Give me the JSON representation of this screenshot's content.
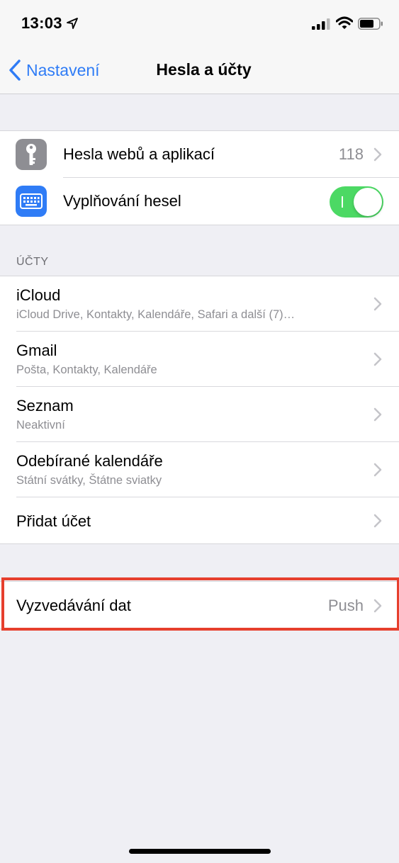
{
  "status_bar": {
    "time": "13:03"
  },
  "nav": {
    "back_label": "Nastavení",
    "title": "Hesla a účty"
  },
  "passwords": {
    "web_passwords_label": "Hesla webů a aplikací",
    "web_passwords_count": "118",
    "autofill_label": "Vyplňování hesel",
    "autofill_enabled": true
  },
  "accounts": {
    "header": "ÚČTY",
    "items": [
      {
        "name": "iCloud",
        "detail": "iCloud Drive, Kontakty, Kalendáře, Safari a další (7)…"
      },
      {
        "name": "Gmail",
        "detail": "Pošta, Kontakty, Kalendáře"
      },
      {
        "name": "Seznam",
        "detail": "Neaktivní"
      },
      {
        "name": "Odebírané kalendáře",
        "detail": "Státní svátky, Štátne sviatky"
      }
    ],
    "add_account_label": "Přidat účet"
  },
  "fetch": {
    "label": "Vyzvedávání dat",
    "value": "Push"
  },
  "colors": {
    "accent": "#2f7cf6",
    "toggle_on": "#4cd964",
    "highlight": "#e63f2d",
    "background": "#efeff4"
  }
}
